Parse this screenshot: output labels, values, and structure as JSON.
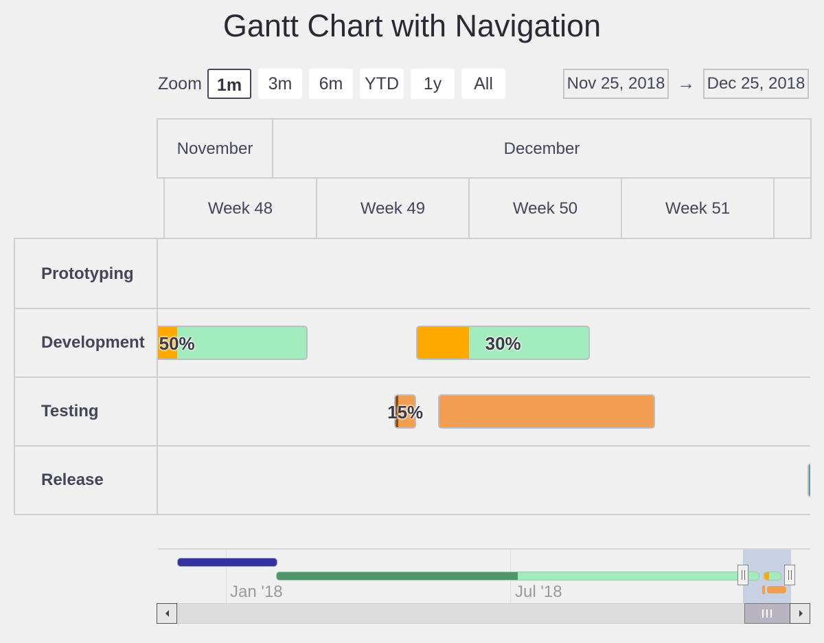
{
  "title": "Gantt Chart with Navigation",
  "range_selector": {
    "zoom_label": "Zoom",
    "buttons": [
      "1m",
      "3m",
      "6m",
      "YTD",
      "1y",
      "All"
    ],
    "selected": "1m",
    "from": "Nov 25, 2018",
    "arrow": "→",
    "to": "Dec 25, 2018"
  },
  "colors": {
    "development": "#a2ebbd",
    "development_done": "#fea800",
    "testing": "#f19e53",
    "testing_done": "#8a4e14",
    "release": "#5a9aa0",
    "grid": "#cfcfcf",
    "nav_series_1": "#3333a0",
    "nav_series_2_done": "#50946a",
    "nav_series_2": "#a2ebbd",
    "nav_mask": "#c7d1e3"
  },
  "chart_data": {
    "type": "gantt",
    "x_range": [
      "2018-11-25",
      "2018-12-25"
    ],
    "header_months": [
      "November",
      "December"
    ],
    "header_weeks": [
      "Week 48",
      "Week 49",
      "Week 50",
      "Week 51"
    ],
    "categories": [
      "Prototyping",
      "Development",
      "Testing",
      "Release"
    ],
    "tasks": [
      {
        "category": "Development",
        "start": "2018-11-20",
        "end": "2018-12-02",
        "completed": 0.5,
        "label": "50%"
      },
      {
        "category": "Development",
        "start": "2018-12-07",
        "end": "2018-12-15",
        "completed": 0.3,
        "label": "30%"
      },
      {
        "category": "Testing",
        "start": "2018-12-06",
        "end": "2018-12-07",
        "completed": 0.15,
        "label": "15%"
      },
      {
        "category": "Testing",
        "start": "2018-12-08",
        "end": "2018-12-18",
        "completed": 0,
        "label": ""
      },
      {
        "category": "Release",
        "start": "2018-12-25",
        "end": "2018-12-27",
        "completed": 0,
        "label": ""
      }
    ],
    "navigator": {
      "labels": [
        "Jan '18",
        "Jul '18"
      ]
    }
  }
}
